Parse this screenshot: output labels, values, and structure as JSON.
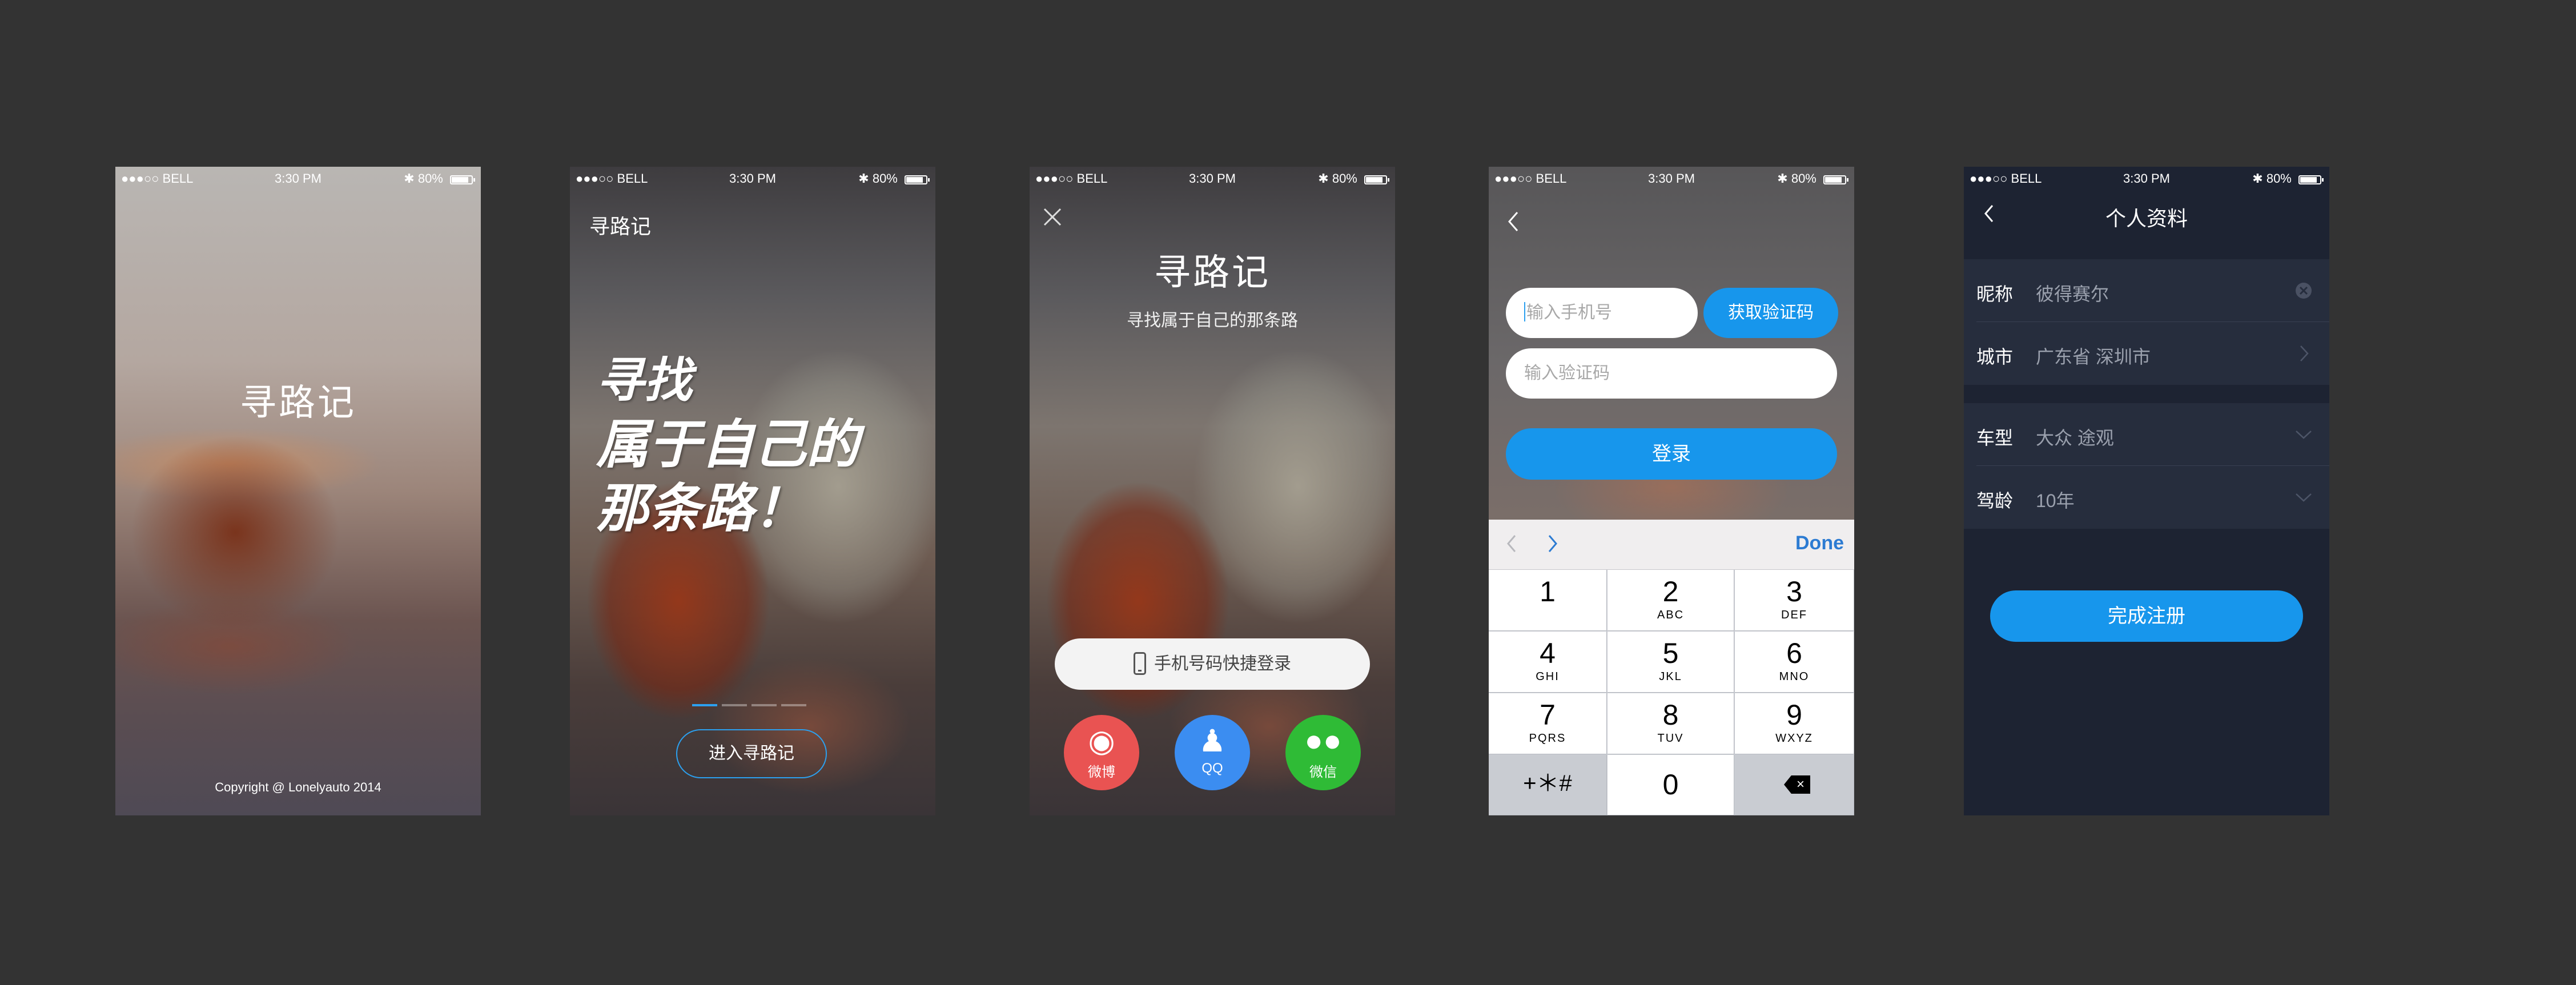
{
  "status_bar": {
    "carrier": "●●●○○ BELL",
    "time": "3:30 PM",
    "battery": "80%"
  },
  "screen1": {
    "title": "寻路记",
    "copyright": "Copyright @ Lonelyauto 2014"
  },
  "screen2": {
    "logo": "寻路记",
    "slogan_lines": [
      "寻找",
      "属于自己的",
      "那条路！"
    ],
    "enter_button": "进入寻路记",
    "page_count": 4,
    "current_page": 1
  },
  "screen3": {
    "title": "寻路记",
    "subtitle": "寻找属于自己的那条路",
    "quick_login": "手机号码快捷登录",
    "social": [
      {
        "label": "微博",
        "icon": "weibo-icon",
        "color": "#e95352"
      },
      {
        "label": "QQ",
        "icon": "qq-icon",
        "color": "#3b8df1"
      },
      {
        "label": "微信",
        "icon": "wechat-icon",
        "color": "#2fbb36"
      }
    ]
  },
  "screen4": {
    "phone_placeholder": "输入手机号",
    "code_placeholder": "输入验证码",
    "get_code": "获取验证码",
    "login": "登录",
    "keyboard_done": "Done",
    "keys": [
      {
        "n": "1",
        "l": ""
      },
      {
        "n": "2",
        "l": "ABC"
      },
      {
        "n": "3",
        "l": "DEF"
      },
      {
        "n": "4",
        "l": "GHI"
      },
      {
        "n": "5",
        "l": "JKL"
      },
      {
        "n": "6",
        "l": "MNO"
      },
      {
        "n": "7",
        "l": "PQRS"
      },
      {
        "n": "8",
        "l": "TUV"
      },
      {
        "n": "9",
        "l": "WXYZ"
      }
    ],
    "symbols_key": "+＊#",
    "zero_key": "0"
  },
  "screen5": {
    "title": "个人资料",
    "rows": [
      {
        "label": "昵称",
        "value": "彼得赛尔"
      },
      {
        "label": "城市",
        "value": "广东省 深圳市"
      },
      {
        "label": "车型",
        "value": "大众 途观"
      },
      {
        "label": "驾龄",
        "value": "10年"
      }
    ],
    "done": "完成注册"
  },
  "colors": {
    "accent": "#1796ec",
    "background": "#333333",
    "profile_bg": "#1d2332"
  }
}
